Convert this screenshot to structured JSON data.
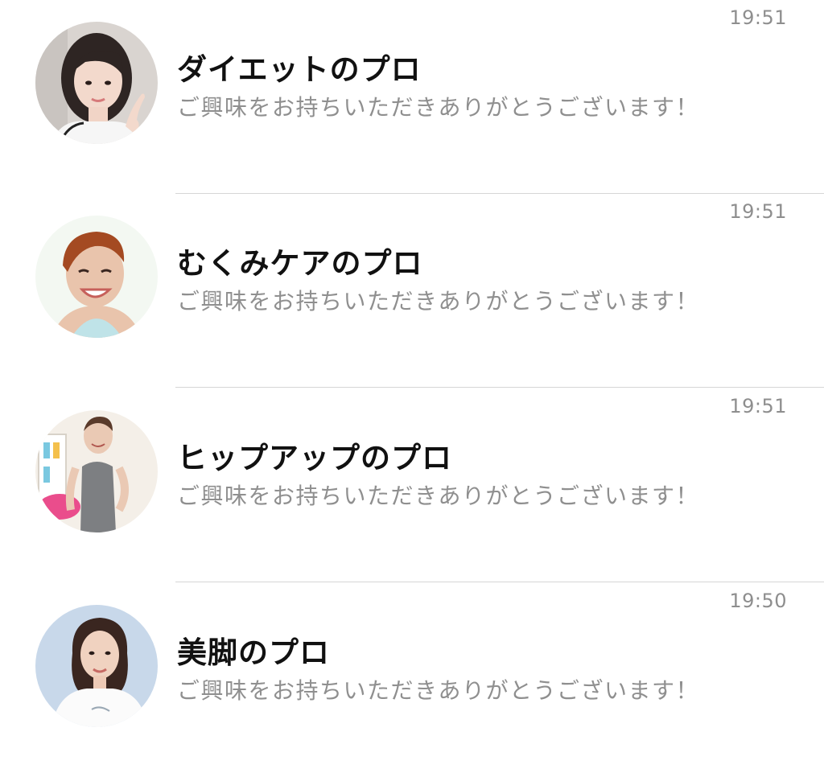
{
  "chats": [
    {
      "name": "ダイエットのプロ",
      "message": "ご興味をお持ちいただきありがとうございます！",
      "time": "19:51"
    },
    {
      "name": "むくみケアのプロ",
      "message": "ご興味をお持ちいただきありがとうございます！",
      "time": "19:51"
    },
    {
      "name": "ヒップアップのプロ",
      "message": "ご興味をお持ちいただきありがとうございます！",
      "time": "19:51"
    },
    {
      "name": "美脚のプロ",
      "message": "ご興味をお持ちいただきありがとうございます！",
      "time": "19:50"
    }
  ],
  "colors": {
    "name_text": "#111111",
    "message_text": "#8f8f8f",
    "time_text": "#8e8e8e",
    "divider": "#d6d6d6",
    "background": "#ffffff"
  }
}
